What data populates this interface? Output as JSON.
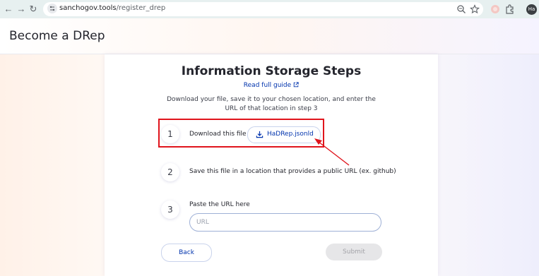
{
  "browser": {
    "url_host": "sanchogov.tools",
    "url_path": "/register_drep",
    "avatar_initials": "Ha"
  },
  "page": {
    "title": "Become a DRep"
  },
  "card": {
    "title": "Information Storage Steps",
    "guide_link": "Read full guide",
    "description": "Download your file, save it to your chosen location, and enter the URL of that location in step 3",
    "steps": [
      {
        "number": "1",
        "text": "Download this file",
        "button_label": "HaDRep.jsonld"
      },
      {
        "number": "2",
        "text": "Save this file in a location that provides a public URL (ex. github)"
      },
      {
        "number": "3",
        "text": "Paste the URL here",
        "placeholder": "URL"
      }
    ],
    "back_label": "Back",
    "submit_label": "Submit"
  },
  "colors": {
    "accent": "#0033ad",
    "highlight": "#e0141c"
  }
}
